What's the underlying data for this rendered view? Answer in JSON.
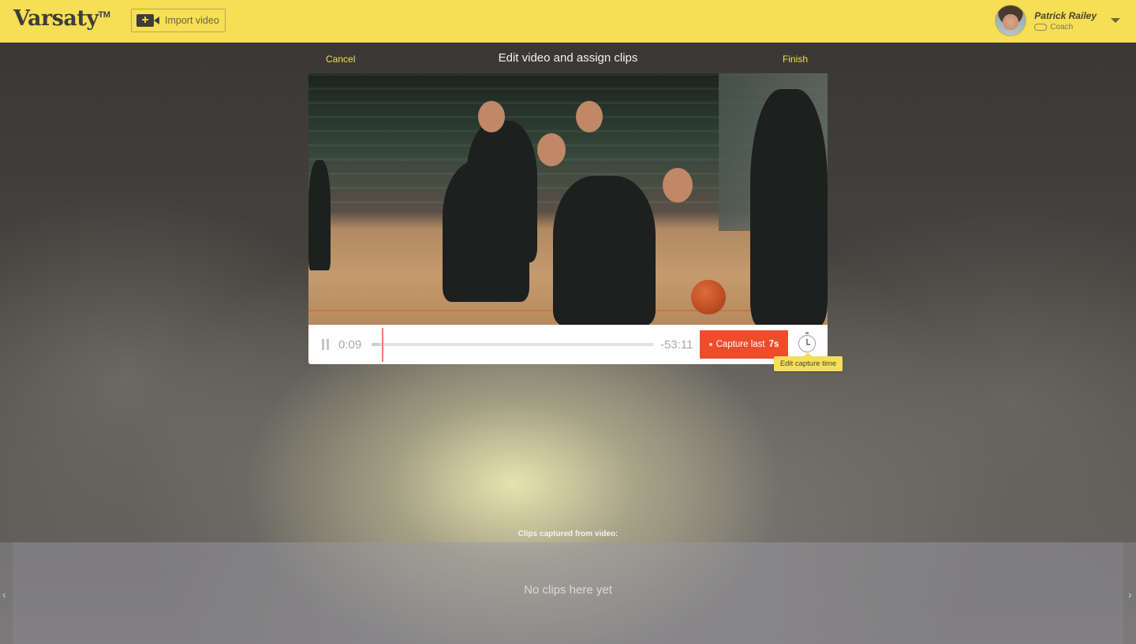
{
  "header": {
    "logo": "Varsaty",
    "logo_tm": "TM",
    "import_label": "Import video",
    "import_icon": "video-camera-plus-icon",
    "user": {
      "name": "Patrick Railey",
      "role": "Coach",
      "role_icon": "whistle-icon",
      "menu_icon": "chevron-down-icon"
    }
  },
  "editor": {
    "cancel_label": "Cancel",
    "title": "Edit video and assign clips",
    "finish_label": "Finish"
  },
  "player": {
    "elapsed": "0:09",
    "remaining": "-53:11",
    "progress_fraction": 0.03,
    "capture_prefix": "Capture last",
    "capture_seconds": "7s",
    "edit_time_icon": "stopwatch-icon",
    "tooltip": "Edit capture time"
  },
  "clips": {
    "label": "Clips captured from video:",
    "empty_text": "No clips here yet",
    "prev_icon": "chevron-left-icon",
    "next_icon": "chevron-right-icon"
  },
  "colors": {
    "brand_yellow": "#f6de55",
    "capture_red": "#f04c2c",
    "playhead": "#ef7c62"
  }
}
